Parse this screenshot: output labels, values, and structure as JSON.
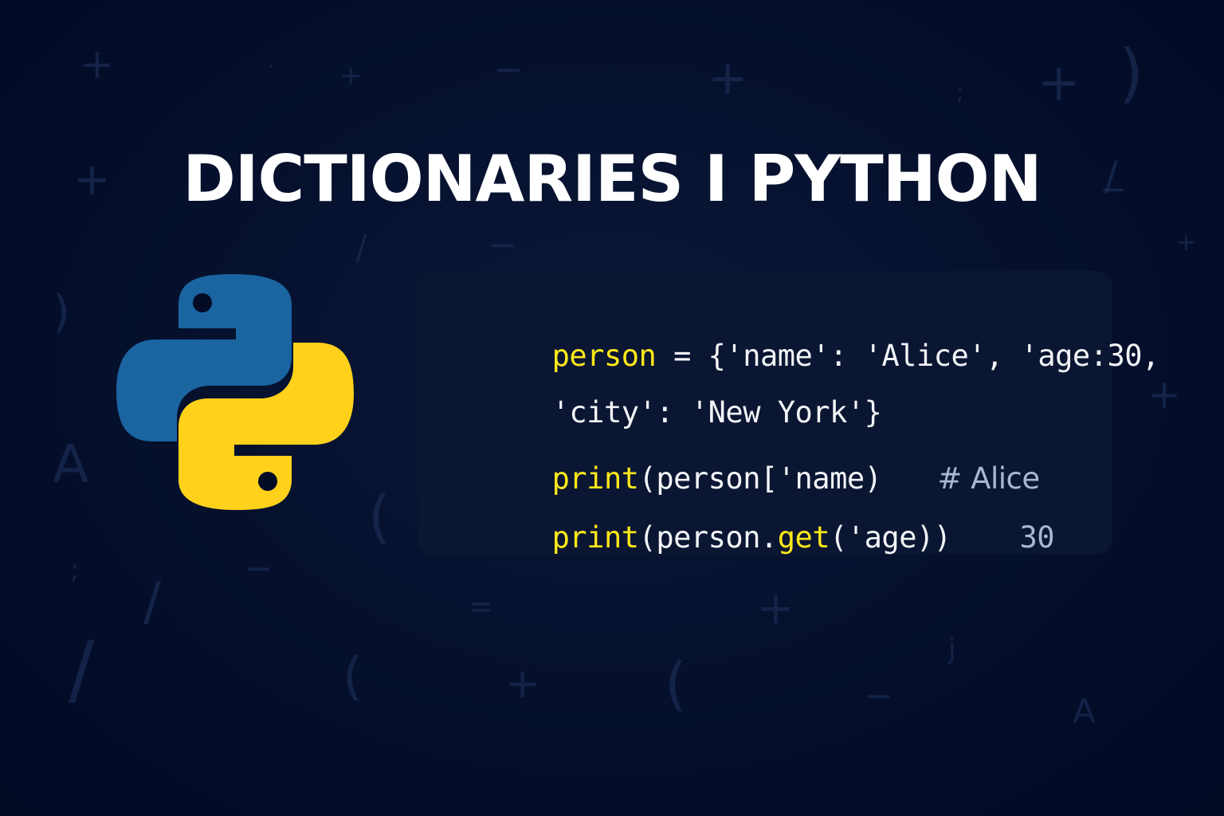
{
  "title": "DICTIONARIES I PYTHON",
  "code": {
    "line1": {
      "var": "person",
      "rest": " = {'name': 'Alice', 'age:30,"
    },
    "line2": {
      "text": "'city': 'New York'}"
    },
    "line3": {
      "fn": "print",
      "args": "(person['name)",
      "comment": "# Alice"
    },
    "line4": {
      "fn": "print",
      "mid": "(person.",
      "method": "get",
      "args_end": "('age))",
      "output": "30"
    }
  },
  "colors": {
    "background": "#020a24",
    "panel": "#0b1632",
    "keyword": "#ffe81a",
    "text": "#f2f4f8",
    "comment": "#a9b7d2",
    "python_blue": "#1a64a0",
    "python_yellow": "#ffd11a"
  },
  "logo": {
    "icon": "python-logo-icon"
  },
  "background_glyphs": [
    "+",
    "+",
    "+",
    "+",
    "+",
    "+",
    "+",
    "+",
    "+",
    "−",
    "−",
    "−",
    "−",
    "−",
    ")",
    ")",
    "(",
    "(",
    "(",
    "/",
    "/",
    "/",
    "/",
    "A",
    "A",
    "=",
    ";",
    ";",
    "j",
    "·"
  ]
}
